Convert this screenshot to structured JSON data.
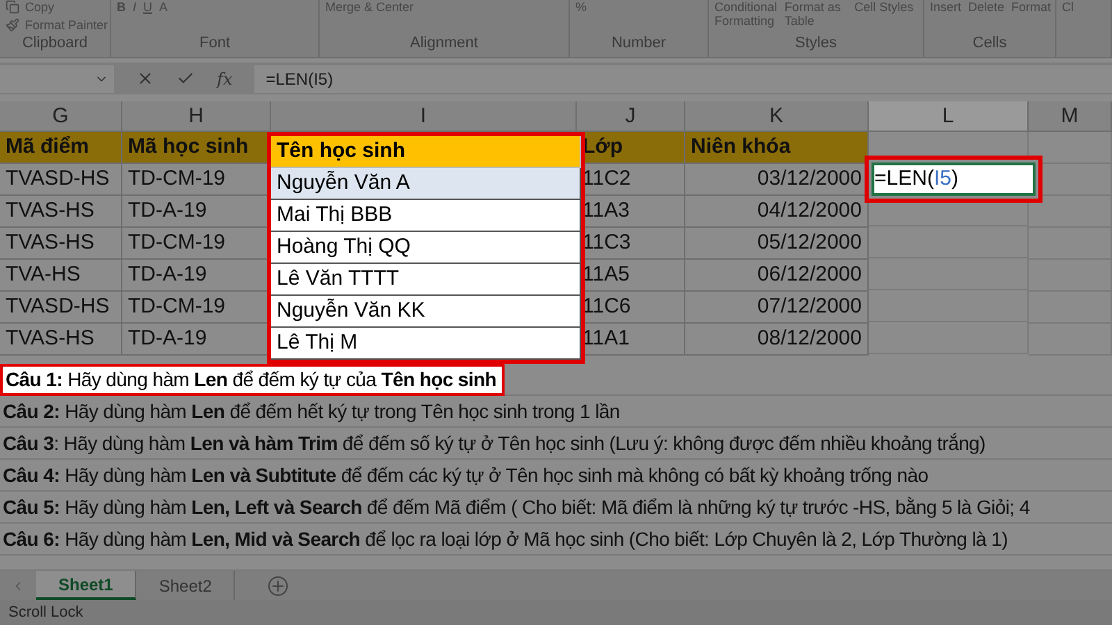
{
  "ribbon": {
    "groups": [
      {
        "label": "Clipboard",
        "items": [
          "Copy",
          "Format Painter"
        ]
      },
      {
        "label": "Font",
        "items": [
          "B",
          "I",
          "U",
          "A"
        ]
      },
      {
        "label": "Alignment",
        "items": [
          "Merge & Center"
        ]
      },
      {
        "label": "Number",
        "items": [
          "%"
        ]
      },
      {
        "label": "Styles",
        "items": [
          "Conditional Formatting",
          "Format as Table",
          "Cell Styles"
        ]
      },
      {
        "label": "Cells",
        "items": [
          "Insert",
          "Delete",
          "Format"
        ]
      },
      {
        "items": [
          "Cl"
        ]
      }
    ]
  },
  "formula_bar": {
    "function_label": "fx",
    "formula": "=LEN(I5)"
  },
  "table": {
    "columns": [
      {
        "letter": "G",
        "header": "Mã điểm",
        "highlighted": false,
        "kind": "text",
        "values": [
          "TVASD-HS",
          "TVAS-HS",
          "TVAS-HS",
          "TVA-HS",
          "TVASD-HS",
          "TVAS-HS"
        ]
      },
      {
        "letter": "H",
        "header": "Mã học sinh",
        "highlighted": false,
        "kind": "text",
        "values": [
          "TD-CM-19",
          "TD-A-19",
          "TD-CM-19",
          "TD-A-19",
          "TD-CM-19",
          "TD-A-19"
        ]
      },
      {
        "letter": "I",
        "header": "Tên học sinh",
        "highlighted": true,
        "kind": "text",
        "values": [
          "Nguyễn Văn A",
          "Mai Thị BBB",
          "Hoàng Thị QQ",
          "Lê Văn TTTT",
          "Nguyễn Văn KK",
          "Lê Thị M"
        ]
      },
      {
        "letter": "J",
        "header": "Lớp",
        "highlighted": false,
        "kind": "text",
        "values": [
          "11C2",
          "11A3",
          "11C3",
          "11A5",
          "11C6",
          "11A1"
        ]
      },
      {
        "letter": "K",
        "header": "Niên khóa",
        "highlighted": false,
        "kind": "date",
        "values": [
          "03/12/2000",
          "04/12/2000",
          "05/12/2000",
          "06/12/2000",
          "07/12/2000",
          "08/12/2000"
        ]
      },
      {
        "letter": "L",
        "selected": true,
        "active_cell": {
          "prefix": "=LEN(",
          "ref": "I5",
          "suffix": ")"
        }
      },
      {
        "letter": "M",
        "selected": false
      }
    ]
  },
  "questions": [
    {
      "text": "**Câu 1:** Hãy dùng hàm **Len** để đếm ký tự của **Tên học sinh**",
      "highlighted": true
    },
    {
      "text": "**Câu 2:** Hãy dùng hàm **Len** để đếm hết ký tự trong Tên học sinh trong 1 lần",
      "highlighted": false
    },
    {
      "text": "**Câu 3**: Hãy dùng hàm **Len và hàm Trim** để đếm số ký tự ở Tên học sinh (Lưu ý: không được đếm nhiều khoảng trắng)",
      "highlighted": false
    },
    {
      "text": "**Câu 4:** Hãy dùng hàm **Len và Subtitute** để đếm các ký tự ở Tên học sinh mà không có bất kỳ khoảng trống nào",
      "highlighted": false
    },
    {
      "text": "**Câu 5:** Hãy dùng hàm **Len, Left và Search** để đếm Mã điểm ( Cho biết: Mã điểm là những ký tự trước -HS, bằng 5 là Giỏi; 4",
      "highlighted": false
    },
    {
      "text": "**Câu 6:** Hãy dùng hàm **Len, Mid và Search** để lọc ra loại lớp ở Mã học sinh (Cho biết: Lớp Chuyên là 2, Lớp Thường là 1)",
      "highlighted": false
    }
  ],
  "sheet_tabs": [
    {
      "label": "Sheet1",
      "selected": true
    },
    {
      "label": "Sheet2",
      "selected": false
    }
  ],
  "status_bar": {
    "text": "Scroll Lock"
  }
}
